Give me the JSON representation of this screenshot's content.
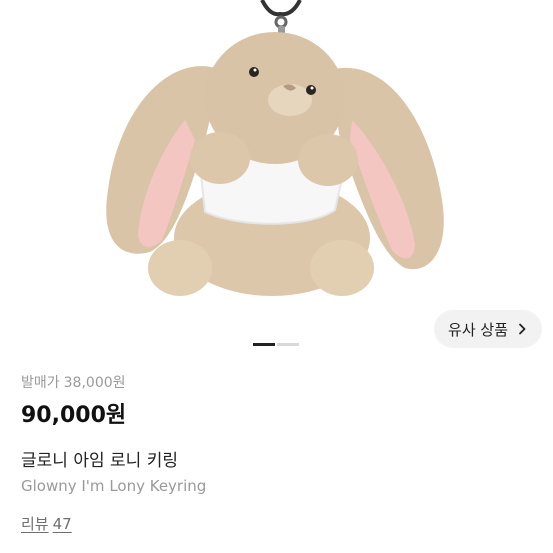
{
  "similar_products": {
    "label": "유사 상품",
    "icon": "chevron-right-icon"
  },
  "image_pager": {
    "total": 2,
    "current": 1
  },
  "product": {
    "original_price_label": "발매가",
    "original_price": "38,000원",
    "price": "90,000원",
    "name_ko": "글로니 아임 로니 키링",
    "name_en": "Glowny I'm Lony Keyring",
    "review_label": "리뷰",
    "review_count": "47"
  },
  "colors": {
    "price": "#111111",
    "muted_text": "#9a9a9a",
    "button_bg": "#f2f2f2",
    "pager_active": "#222222",
    "pager_inactive": "#d9d9d9"
  }
}
